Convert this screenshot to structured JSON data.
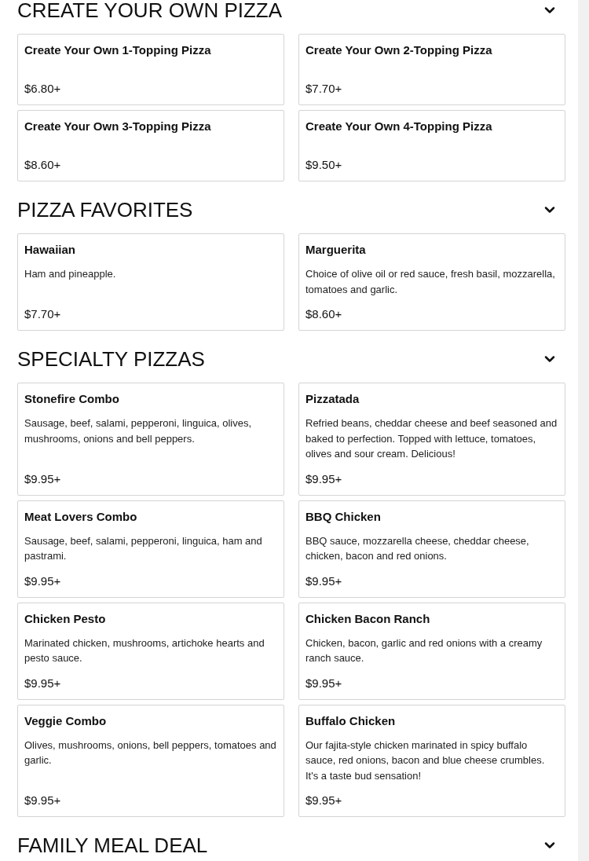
{
  "sections": [
    {
      "title": "CREATE YOUR OWN PIZZA",
      "items": [
        {
          "name": "Create Your Own 1-Topping Pizza",
          "price": "$6.80+"
        },
        {
          "name": "Create Your Own 2-Topping Pizza",
          "price": "$7.70+"
        },
        {
          "name": "Create Your Own 3-Topping Pizza",
          "price": "$8.60+"
        },
        {
          "name": "Create Your Own 4-Topping Pizza",
          "price": "$9.50+"
        }
      ]
    },
    {
      "title": "PIZZA FAVORITES",
      "items": [
        {
          "name": "Hawaiian",
          "description": "Ham and pineapple.",
          "price": "$7.70+"
        },
        {
          "name": "Marguerita",
          "description": "Choice of olive oil or red sauce, fresh basil, mozzarella, tomatoes and garlic.",
          "price": "$8.60+"
        }
      ]
    },
    {
      "title": "SPECIALTY PIZZAS",
      "items": [
        {
          "name": "Stonefire Combo",
          "description": "Sausage, beef, salami, pepperoni, linguica, olives, mushrooms, onions and bell peppers.",
          "price": "$9.95+"
        },
        {
          "name": "Pizzatada",
          "description": "Refried beans, cheddar cheese and beef seasoned and baked to perfection. Topped with lettuce, tomatoes, olives and sour cream. Delicious!",
          "price": "$9.95+"
        },
        {
          "name": "Meat Lovers Combo",
          "description": "Sausage, beef, salami, pepperoni, linguica, ham and pastrami.",
          "price": "$9.95+"
        },
        {
          "name": "BBQ Chicken",
          "description": "BBQ sauce, mozzarella cheese, cheddar cheese, chicken, bacon and red onions.",
          "price": "$9.95+"
        },
        {
          "name": "Chicken Pesto",
          "description": "Marinated chicken, mushrooms, artichoke hearts and pesto sauce.",
          "price": "$9.95+"
        },
        {
          "name": "Chicken Bacon Ranch",
          "description": "Chicken, bacon, garlic and red onions with a creamy ranch sauce.",
          "price": "$9.95+"
        },
        {
          "name": "Veggie Combo",
          "description": "Olives, mushrooms, onions, bell peppers, tomatoes and garlic.",
          "price": "$9.95+"
        },
        {
          "name": "Buffalo Chicken",
          "description": "Our fajita-style chicken marinated in spicy buffalo sauce, red onions, bacon and blue cheese crumbles. It's a taste bud sensation!",
          "price": "$9.95+"
        }
      ]
    },
    {
      "title": "FAMILY MEAL DEAL"
    }
  ]
}
